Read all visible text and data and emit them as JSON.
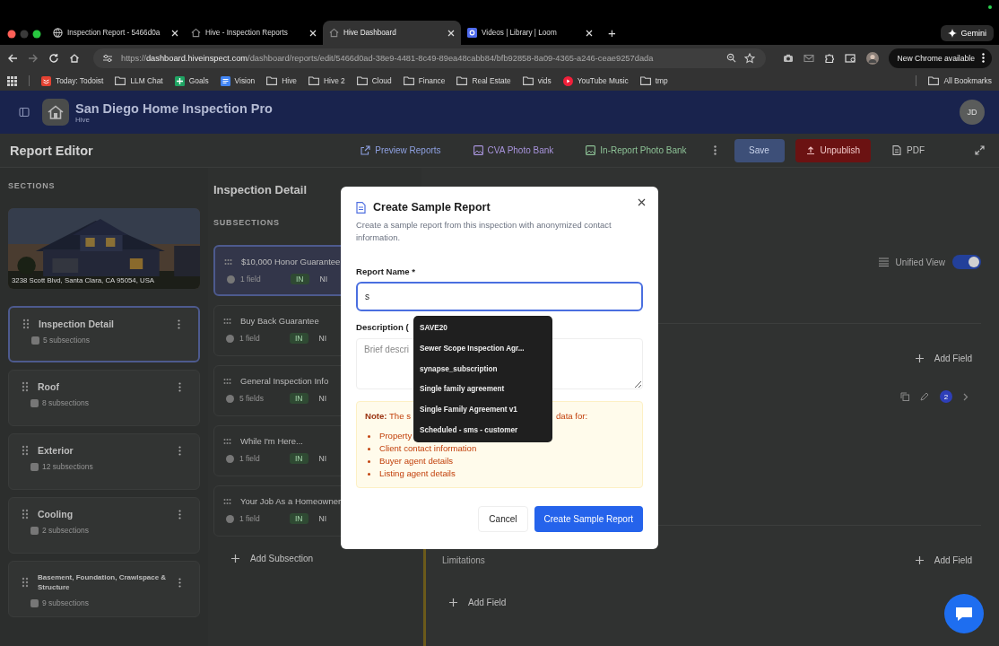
{
  "browser": {
    "tabs": [
      {
        "title": "Inspection Report - 5466d0a",
        "kind": "globe",
        "selected": false
      },
      {
        "title": "Hive - Inspection Reports",
        "kind": "hive",
        "selected": false
      },
      {
        "title": "Hive Dashboard",
        "kind": "hive",
        "selected": true
      },
      {
        "title": "Videos | Library | Loom",
        "kind": "loom",
        "selected": false
      }
    ],
    "new_tab": "+",
    "gemini": "Gemini",
    "url": {
      "scheme": "https://",
      "host": "dashboard.hiveinspect.com",
      "path": "/dashboard/reports/edit/5466d0ad-38e9-4481-8c49-89ea48cabb84/bfb92858-8a09-4365-a246-ceae9257dada"
    },
    "update": "New Chrome available",
    "bookmarks": [
      {
        "label": "Today: Todoist",
        "kind": "todoist"
      },
      {
        "label": "LLM Chat",
        "kind": "folder"
      },
      {
        "label": "Goals",
        "kind": "sheet"
      },
      {
        "label": "Vision",
        "kind": "doc"
      },
      {
        "label": "Hive",
        "kind": "folder"
      },
      {
        "label": "Hive 2",
        "kind": "folder"
      },
      {
        "label": "Cloud",
        "kind": "folder"
      },
      {
        "label": "Finance",
        "kind": "folder"
      },
      {
        "label": "Real Estate",
        "kind": "folder"
      },
      {
        "label": "vids",
        "kind": "folder"
      },
      {
        "label": "YouTube Music",
        "kind": "music"
      },
      {
        "label": "tmp",
        "kind": "folder"
      }
    ],
    "all_bookmarks": "All Bookmarks"
  },
  "header": {
    "org": "San Diego Home Inspection Pro",
    "org_sub": "Hive",
    "avatar": "JD"
  },
  "toolbar": {
    "title": "Report Editor",
    "links": [
      {
        "label": "Preview Reports",
        "kind": "preview"
      },
      {
        "label": "CVA Photo Bank",
        "kind": "cva"
      },
      {
        "label": "In-Report Photo Bank",
        "kind": "inreport"
      }
    ],
    "save": "Save",
    "unpublish": "Unpublish",
    "pdf": "PDF"
  },
  "sections": {
    "heading": "SECTIONS",
    "address": "3238 Scott Blvd, Santa Clara, CA 95054, USA",
    "items": [
      {
        "title": "Inspection Detail",
        "meta": "5 subsections",
        "selected": true
      },
      {
        "title": "Roof",
        "meta": "8 subsections",
        "selected": false
      },
      {
        "title": "Exterior",
        "meta": "12 subsections",
        "selected": false
      },
      {
        "title": "Cooling",
        "meta": "2 subsections",
        "selected": false
      },
      {
        "title": "Basement, Foundation, Crawlspace & Structure",
        "meta": "9 subsections",
        "selected": false
      }
    ]
  },
  "subsections": {
    "title": "Inspection Detail",
    "heading": "SUBSECTIONS",
    "items": [
      {
        "title": "$10,000 Honor Guarantee",
        "fields": "1 field",
        "in": "IN",
        "ni": "NI",
        "selected": true
      },
      {
        "title": "Buy Back Guarantee",
        "fields": "1 field",
        "in": "IN",
        "ni": "NI",
        "selected": false
      },
      {
        "title": "General Inspection Info",
        "fields": "5 fields",
        "in": "IN",
        "ni": "NI",
        "selected": false
      },
      {
        "title": "While I'm Here...",
        "fields": "1 field",
        "in": "IN",
        "ni": "NI",
        "selected": false
      },
      {
        "title": "Your Job As a Homeowner",
        "fields": "1 field",
        "in": "IN",
        "ni": "NI",
        "selected": false
      }
    ],
    "add": "Add Subsection"
  },
  "detail": {
    "unified_view": {
      "label": "Unified View",
      "on": true
    },
    "add_field_top": "Add Field",
    "badge": "2",
    "limitations": "Limitations",
    "add_field_limitations": "Add Field",
    "add_field_bottom": "Add Field"
  },
  "modal": {
    "title": "Create Sample Report",
    "description": "Create a sample report from this inspection with anonymized contact information.",
    "name_label": "Report Name *",
    "name_value": "s",
    "description_label": "Description (",
    "description_placeholder": "Brief descri",
    "note_lead": "Note:",
    "note_start": "The s",
    "note_end": "data for:",
    "note_items": [
      "Property",
      "Client contact information",
      "Buyer agent details",
      "Listing agent details"
    ],
    "cancel": "Cancel",
    "submit": "Create Sample Report"
  },
  "autocomplete": [
    "SAVE20",
    "Sewer Scope Inspection Agr...",
    "synapse_subscription",
    "Single family agreement",
    "Single Family Agreement v1",
    "Scheduled - sms - customer"
  ]
}
